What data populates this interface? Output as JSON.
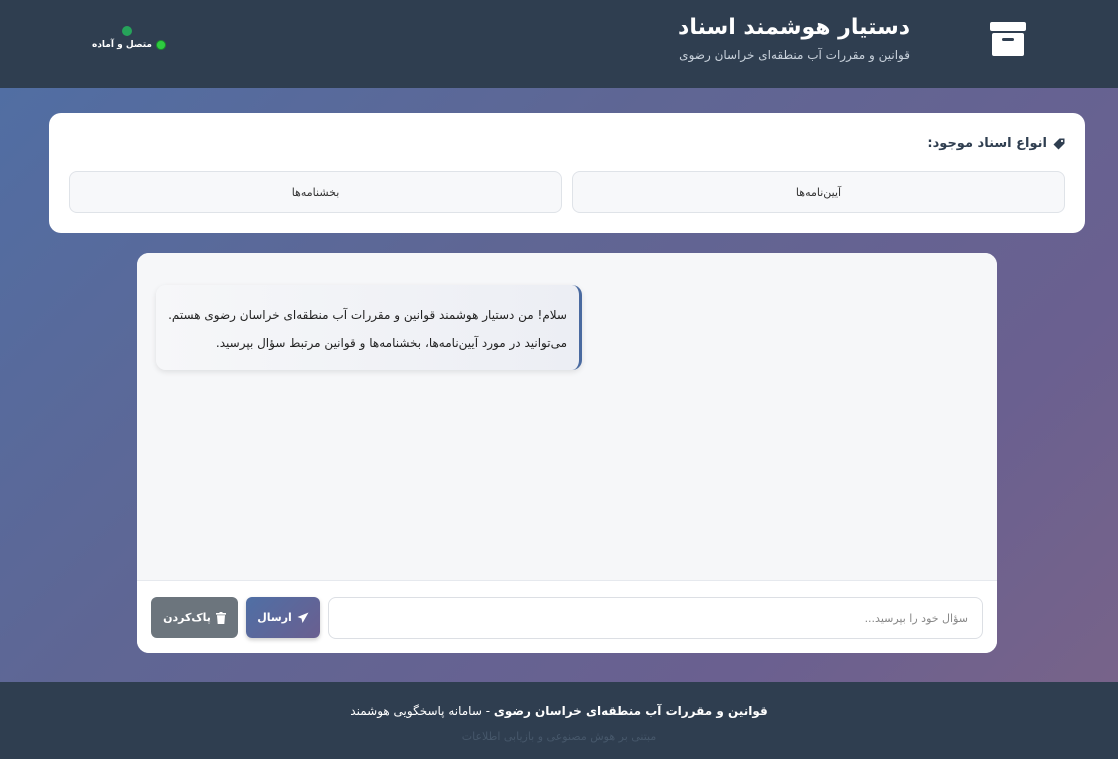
{
  "header": {
    "title": "دستیار هوشمند اسناد",
    "subtitle": "قوانین و مقررات آب منطقه‌ای خراسان رضوی",
    "status": "متصل و آماده",
    "logo_icon": "archive-box-icon"
  },
  "doc_types": {
    "label": "انواع اسناد موجود:",
    "label_icon": "tag-icon",
    "items": [
      {
        "label": "آیین‌نامه‌ها"
      },
      {
        "label": "بخشنامه‌ها"
      }
    ]
  },
  "chat": {
    "welcome_line1": "سلام! من دستیار هوشمند قوانین و مقررات آب منطقه‌ای خراسان رضوی هستم.",
    "welcome_line2": "می‌توانید در مورد آیین‌نامه‌ها، بخشنامه‌ها و قوانین مرتبط سؤال بپرسید.",
    "input_placeholder": "سؤال خود را بپرسید...",
    "send_label": "ارسال",
    "send_icon": "paper-plane-icon",
    "clear_label": "پاک‌کردن",
    "clear_icon": "trash-icon"
  },
  "footer": {
    "main_bold": "قوانین و مقررات آب منطقه‌ای خراسان رضوی",
    "main_rest": " - سامانه پاسخگویی هوشمند",
    "sub": "مبتنی بر هوش مصنوعی و بازیابی اطلاعات"
  },
  "colors": {
    "header_bg": "#2f3e50",
    "accent": "#4f6fa5",
    "status_green": "#2ecc40",
    "clear_button": "#6c757d"
  }
}
